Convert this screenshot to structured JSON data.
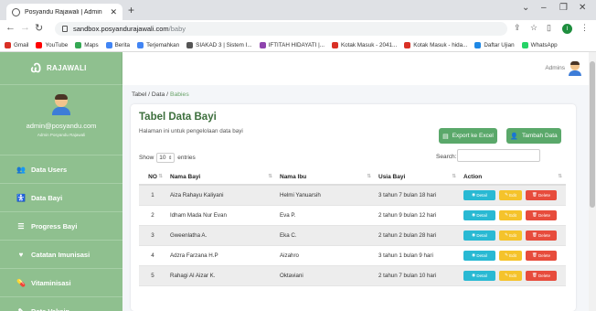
{
  "browser": {
    "tab_title": "Posyandu Rajawali | Admin",
    "url_domain": "sandbox.posyandurajawali.com",
    "url_path": "/baby",
    "bookmarks": [
      {
        "label": "Gmail",
        "color": "#d93025"
      },
      {
        "label": "YouTube",
        "color": "#ff0000"
      },
      {
        "label": "Maps",
        "color": "#34a853"
      },
      {
        "label": "Berita",
        "color": "#4285f4"
      },
      {
        "label": "Terjemahkan",
        "color": "#4285f4"
      },
      {
        "label": "SIAKAD 3 | Sistem I...",
        "color": "#555555"
      },
      {
        "label": "IFTITAH HIDAYATI |...",
        "color": "#8e44ad"
      },
      {
        "label": "Kotak Masuk - 2041...",
        "color": "#d93025"
      },
      {
        "label": "Kotak Masuk - hida...",
        "color": "#d93025"
      },
      {
        "label": "Daftar Ujian",
        "color": "#1e88e5"
      },
      {
        "label": "WhatsApp",
        "color": "#25d366"
      }
    ]
  },
  "sidebar": {
    "brand": "RAJAWALI",
    "email": "admin@posyandu.com",
    "role": "Admin Posyandu Rajawali",
    "items": [
      {
        "label": "Data Users",
        "icon": "users-icon",
        "glyph": "👥"
      },
      {
        "label": "Data Bayi",
        "icon": "baby-icon",
        "glyph": "🚼"
      },
      {
        "label": "Progress Bayi",
        "icon": "list-icon",
        "glyph": "☰"
      },
      {
        "label": "Catatan Imunisasi",
        "icon": "heart-icon",
        "glyph": "♥"
      },
      {
        "label": "Vitaminisasi",
        "icon": "pills-icon",
        "glyph": "💊"
      },
      {
        "label": "Data Vaksin",
        "icon": "syringe-icon",
        "glyph": "✎"
      }
    ]
  },
  "topbar": {
    "user": "Admins"
  },
  "breadcrumb": {
    "part1": "Tabel / Data / ",
    "active": "Babies"
  },
  "card": {
    "title": "Tabel Data Bayi",
    "subtitle": "Halaman ini untuk pengelolaan data bayi",
    "export_label": "Export ke Excel",
    "add_label": "Tambah Data",
    "show_label": "Show",
    "show_value": "10",
    "entries_label": "entries",
    "search_label": "Search:"
  },
  "table": {
    "headers": [
      "NO",
      "Nama Bayi",
      "Nama Ibu",
      "Usia Bayi",
      "Action"
    ],
    "action_labels": {
      "detail": "Detail",
      "edit": "Edit",
      "delete": "Delete"
    },
    "rows": [
      {
        "no": "1",
        "bayi": "Aiza Rahayu Kaliyani",
        "ibu": "Helmi Yanuarsih",
        "usia": "3 tahun 7 bulan 18 hari"
      },
      {
        "no": "2",
        "bayi": "Idham Mada Nur Evan",
        "ibu": "Eva P.",
        "usia": "2 tahun 9 bulan 12 hari"
      },
      {
        "no": "3",
        "bayi": "Gweenlatha A.",
        "ibu": "Eka C.",
        "usia": "2 tahun 2 bulan 28 hari"
      },
      {
        "no": "4",
        "bayi": "Adzra Farzana H.P",
        "ibu": "Aizahro",
        "usia": "3 tahun 1 bulan 9 hari"
      },
      {
        "no": "5",
        "bayi": "Rahagi Al Aizar K.",
        "ibu": "Oktaviani",
        "usia": "2 tahun 7 bulan 10 hari"
      }
    ]
  }
}
